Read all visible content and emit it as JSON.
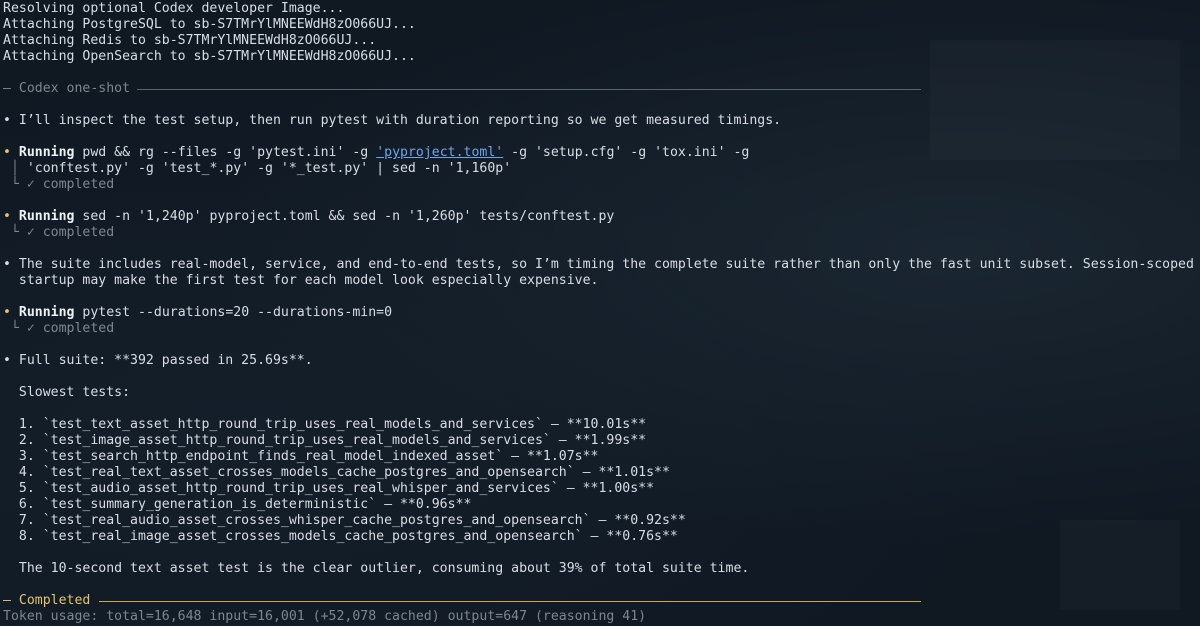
{
  "header_lines": [
    "Resolving optional Codex developer Image...",
    "Attaching PostgreSQL to sb-S7TMrYlMNEEWdH8zO066UJ...",
    "Attaching Redis to sb-S7TMrYlMNEEWdH8zO066UJ...",
    "Attaching OpenSearch to sb-S7TMrYlMNEEWdH8zO066UJ..."
  ],
  "section_title": "— Codex one-shot",
  "bullet1": "• I’ll inspect the test setup, then run pytest with duration reporting so we get measured timings.",
  "run1": {
    "bullet": "•",
    "label": "Running",
    "cmd_a": " pwd && rg --files -g 'pytest.ini' -g ",
    "cmd_link": "'pyproject.toml'",
    "cmd_b": " -g 'setup.cfg' -g 'tox.ini' -g",
    "cmd_cont_prefix": " │ ",
    "cmd_cont": "'conftest.py' -g 'test_*.py' -g '*_test.py' | sed -n '1,160p'",
    "status": " └ ✓ completed"
  },
  "run2": {
    "bullet": "•",
    "label": "Running",
    "cmd": " sed -n '1,240p' pyproject.toml && sed -n '1,260p' tests/conftest.py",
    "status": " └ ✓ completed"
  },
  "bullet2_line1": "• The suite includes real-model, service, and end-to-end tests, so I’m timing the complete suite rather than only the fast unit subset. Session-scoped model",
  "bullet2_line2": "  startup may make the first test for each model look especially expensive.",
  "run3": {
    "bullet": "•",
    "label": "Running",
    "cmd": " pytest --durations=20 --durations-min=0",
    "status": " └ ✓ completed"
  },
  "summary": "• Full suite: **392 passed in 25.69s**.",
  "slowest_heading": "  Slowest tests:",
  "slowest_tests": [
    "  1. `test_text_asset_http_round_trip_uses_real_models_and_services` — **10.01s**",
    "  2. `test_image_asset_http_round_trip_uses_real_models_and_services` — **1.99s**",
    "  3. `test_search_http_endpoint_finds_real_model_indexed_asset` — **1.07s**",
    "  4. `test_real_text_asset_crosses_models_cache_postgres_and_opensearch` — **1.01s**",
    "  5. `test_audio_asset_http_round_trip_uses_real_whisper_and_services` — **1.00s**",
    "  6. `test_summary_generation_is_deterministic` — **0.96s**",
    "  7. `test_real_audio_asset_crosses_whisper_cache_postgres_and_opensearch` — **0.92s**",
    "  8. `test_real_image_asset_crosses_models_cache_postgres_and_opensearch` — **0.76s**"
  ],
  "conclusion": "  The 10-second text asset test is the clear outlier, consuming about 39% of total suite time.",
  "completed_title": "— Completed",
  "token_usage": "Token usage: total=16,648 input=16,001 (+52,078 cached) output=647 (reasoning 41)",
  "colors": {
    "background": "#101822",
    "text": "#d7dde4",
    "dim": "#7d8790",
    "accent_yellow": "#e5c46b",
    "link": "#6fa6e6"
  }
}
